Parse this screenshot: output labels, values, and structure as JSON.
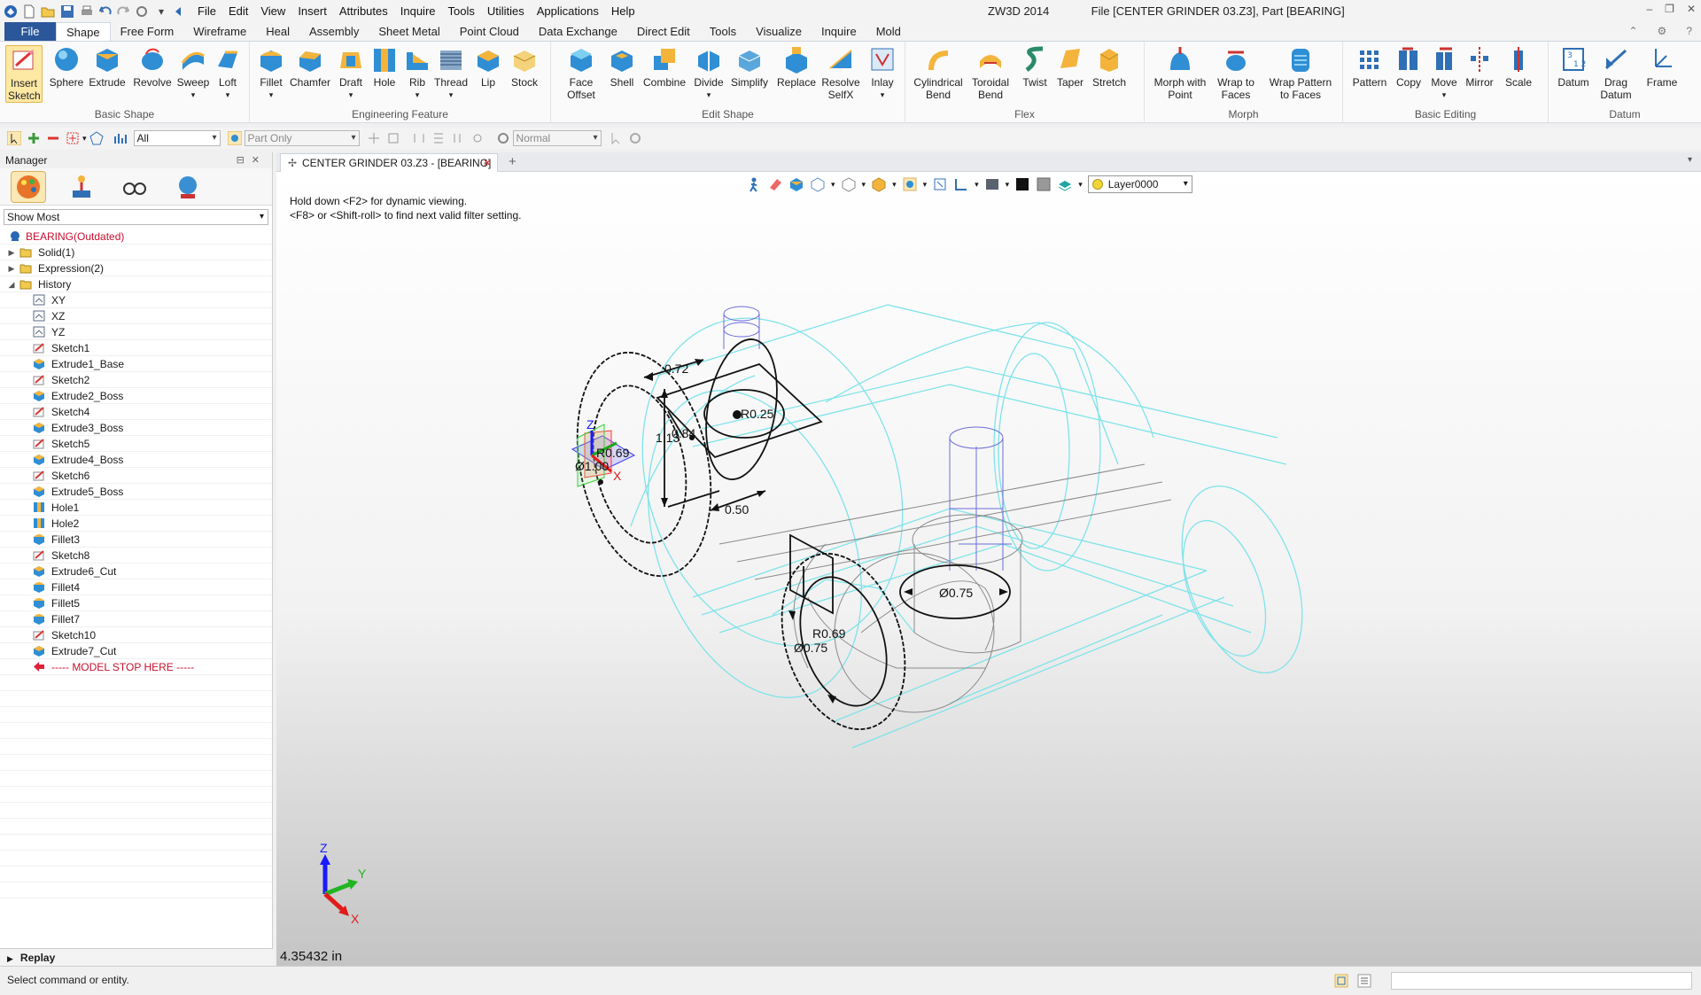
{
  "app": {
    "version_title": "ZW3D 2014",
    "file_title": "File [CENTER GRINDER 03.Z3],  Part [BEARING]"
  },
  "menu": [
    "File",
    "Edit",
    "View",
    "Insert",
    "Attributes",
    "Inquire",
    "Tools",
    "Utilities",
    "Applications",
    "Help"
  ],
  "ribbon_tabs": [
    "File",
    "Shape",
    "Free Form",
    "Wireframe",
    "Heal",
    "Assembly",
    "Sheet Metal",
    "Point Cloud",
    "Data Exchange",
    "Direct Edit",
    "Tools",
    "Visualize",
    "Inquire",
    "Mold"
  ],
  "ribbon_active_tab": "Shape",
  "ribbon_groups": {
    "basic_shape": {
      "label": "Basic Shape",
      "buttons": [
        "Insert Sketch",
        "Sphere",
        "Extrude",
        "Revolve",
        "Sweep",
        "Loft"
      ]
    },
    "engineering_feature": {
      "label": "Engineering Feature",
      "buttons": [
        "Fillet",
        "Chamfer",
        "Draft",
        "Hole",
        "Rib",
        "Thread",
        "Lip",
        "Stock"
      ]
    },
    "edit_shape": {
      "label": "Edit Shape",
      "buttons": [
        "Face Offset",
        "Shell",
        "Combine",
        "Divide",
        "Simplify",
        "Replace",
        "Resolve SelfX",
        "Inlay"
      ]
    },
    "flex": {
      "label": "Flex",
      "buttons": [
        "Cylindrical Bend",
        "Toroidal Bend",
        "Twist",
        "Taper",
        "Stretch"
      ]
    },
    "morph": {
      "label": "Morph",
      "buttons": [
        "Morph with Point",
        "Wrap to Faces",
        "Wrap Pattern to Faces"
      ]
    },
    "basic_editing": {
      "label": "Basic Editing",
      "buttons": [
        "Pattern",
        "Copy",
        "Move",
        "Mirror",
        "Scale"
      ]
    },
    "datum": {
      "label": "Datum",
      "buttons": [
        "Datum",
        "Drag Datum",
        "Frame"
      ]
    }
  },
  "toolbar2": {
    "filter_value": "All",
    "scope_value": "Part Only",
    "mode_value": "Normal"
  },
  "manager": {
    "title": "Manager",
    "show_filter": "Show Most",
    "tree": [
      {
        "label": "BEARING(Outdated)",
        "level": 0,
        "icon": "part-icon",
        "red": true
      },
      {
        "label": "Solid(1)",
        "level": 1,
        "icon": "folder-icon",
        "expander": "▶"
      },
      {
        "label": "Expression(2)",
        "level": 1,
        "icon": "folder-icon",
        "expander": "▶"
      },
      {
        "label": "History",
        "level": 1,
        "icon": "folder-icon",
        "expander": "◢"
      },
      {
        "label": "XY",
        "level": 2,
        "icon": "datum-plane-icon"
      },
      {
        "label": "XZ",
        "level": 2,
        "icon": "datum-plane-icon"
      },
      {
        "label": "YZ",
        "level": 2,
        "icon": "datum-plane-icon"
      },
      {
        "label": "Sketch1",
        "level": 2,
        "icon": "sketch-icon"
      },
      {
        "label": "Extrude1_Base",
        "level": 2,
        "icon": "extrude-icon"
      },
      {
        "label": "Sketch2",
        "level": 2,
        "icon": "sketch-icon"
      },
      {
        "label": "Extrude2_Boss",
        "level": 2,
        "icon": "extrude-icon"
      },
      {
        "label": "Sketch4",
        "level": 2,
        "icon": "sketch-icon"
      },
      {
        "label": "Extrude3_Boss",
        "level": 2,
        "icon": "extrude-icon"
      },
      {
        "label": "Sketch5",
        "level": 2,
        "icon": "sketch-icon"
      },
      {
        "label": "Extrude4_Boss",
        "level": 2,
        "icon": "extrude-icon"
      },
      {
        "label": "Sketch6",
        "level": 2,
        "icon": "sketch-icon"
      },
      {
        "label": "Extrude5_Boss",
        "level": 2,
        "icon": "extrude-icon"
      },
      {
        "label": "Hole1",
        "level": 2,
        "icon": "hole-icon"
      },
      {
        "label": "Hole2",
        "level": 2,
        "icon": "hole-icon"
      },
      {
        "label": "Fillet3",
        "level": 2,
        "icon": "fillet-icon"
      },
      {
        "label": "Sketch8",
        "level": 2,
        "icon": "sketch-icon"
      },
      {
        "label": "Extrude6_Cut",
        "level": 2,
        "icon": "extrude-icon"
      },
      {
        "label": "Fillet4",
        "level": 2,
        "icon": "fillet-icon"
      },
      {
        "label": "Fillet5",
        "level": 2,
        "icon": "fillet-icon"
      },
      {
        "label": "Fillet7",
        "level": 2,
        "icon": "fillet-icon"
      },
      {
        "label": "Sketch10",
        "level": 2,
        "icon": "sketch-icon"
      },
      {
        "label": "Extrude7_Cut",
        "level": 2,
        "icon": "extrude-icon"
      },
      {
        "label": "----- MODEL STOP HERE -----",
        "level": 2,
        "icon": "stop-arrow-icon",
        "red": true
      }
    ],
    "replay_label": "Replay"
  },
  "document_tab": "CENTER GRINDER 03.Z3 - [BEARING]",
  "viewport": {
    "hint_line1": "Hold down <F2> for dynamic viewing.",
    "hint_line2": "<F8> or <Shift-roll> to find next valid filter setting.",
    "layer": "Layer0000",
    "units_readout": "4.35432 in",
    "dims": {
      "d1": "0.72",
      "d2": "R0.25",
      "d3": "1.13",
      "d4": "0.84",
      "d5": "R0.69",
      "d6": "Ø1.00",
      "d7": "0.50",
      "d8": "Ø0.75",
      "d9": "R0.69",
      "d10": "Ø0.75"
    },
    "axis_labels": {
      "x": "X",
      "y": "Y",
      "z": "Z"
    }
  },
  "status": {
    "message": "Select command or entity."
  },
  "colors": {
    "file_tab": "#2b579a",
    "wire_cyan": "#7fe3ea",
    "sketch_blue": "#6d6ddd",
    "highlight": "#fde8a4"
  }
}
